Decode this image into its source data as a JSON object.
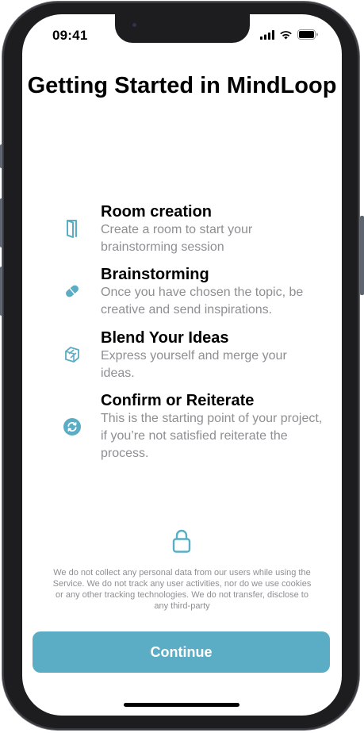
{
  "status": {
    "time": "09:41"
  },
  "page": {
    "title": "Getting Started in MindLoop"
  },
  "features": [
    {
      "title": "Room creation",
      "description": "Create a room to start your brainstorming session",
      "icon": "door-icon"
    },
    {
      "title": "Brainstorming",
      "description": "Once you have chosen the topic, be creative and send inspirations.",
      "icon": "capsule-icon"
    },
    {
      "title": "Blend Your Ideas",
      "description": "Express yourself and merge your ideas.",
      "icon": "layers-icon"
    },
    {
      "title": "Confirm or Reiterate",
      "description": "This is the starting point of your project, if you’re not satisfied reiterate the process.",
      "icon": "refresh-circle-icon"
    }
  ],
  "privacy": {
    "icon": "lock-icon",
    "text": "We do not collect any personal data from our users while using the Service. We do not track any user activities, nor do we use cookies or any other tracking technologies. We do not transfer, disclose to any third-party"
  },
  "actions": {
    "continue_label": "Continue"
  },
  "colors": {
    "accent": "#5aadc4",
    "secondary_text": "#8e8e93"
  }
}
